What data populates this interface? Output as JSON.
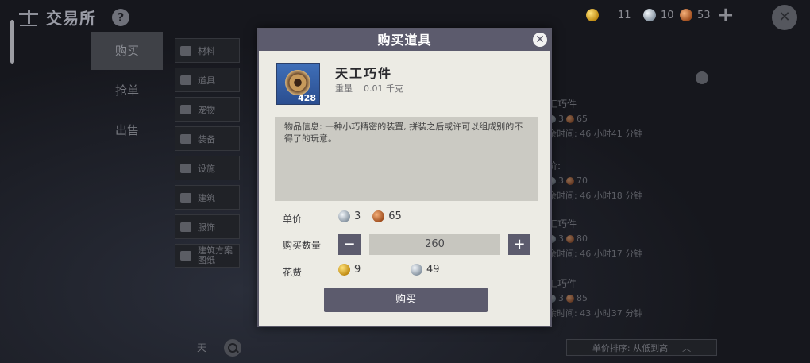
{
  "header": {
    "title": "交易所",
    "help_label": "?",
    "currency": {
      "gold": "11",
      "silver": "10",
      "copper": "53"
    },
    "add_label": "+",
    "close_label": "✕"
  },
  "left_tabs": [
    {
      "label": "购买",
      "active": true
    },
    {
      "label": "抢单",
      "active": false
    },
    {
      "label": "出售",
      "active": false
    }
  ],
  "categories": [
    {
      "label": "材料",
      "icon": "material-icon"
    },
    {
      "label": "道具",
      "icon": "prop-icon"
    },
    {
      "label": "宠物",
      "icon": "pet-icon"
    },
    {
      "label": "装备",
      "icon": "equipment-icon"
    },
    {
      "label": "设施",
      "icon": "facility-icon"
    },
    {
      "label": "建筑",
      "icon": "building-icon"
    },
    {
      "label": "服饰",
      "icon": "clothing-icon"
    },
    {
      "label": "建筑方案\n图纸",
      "icon": "blueprint-icon"
    }
  ],
  "search": {
    "value": "天"
  },
  "listings": [
    {
      "name": "工巧件",
      "silver": "3",
      "copper": "65",
      "time": "余时间: 46 小时41 分钟"
    },
    {
      "name": "价:",
      "silver": "3",
      "copper": "70",
      "time": "余时间: 46 小时18 分钟"
    },
    {
      "name": "工巧件",
      "silver": "3",
      "copper": "80",
      "time": "余时间: 46 小时17 分钟"
    },
    {
      "name": "工巧件",
      "silver": "3",
      "copper": "85",
      "time": "余时间: 43 小时37 分钟"
    }
  ],
  "sort": {
    "label": "单价排序: 从低到高",
    "icon": "chevron-up-icon"
  },
  "modal": {
    "title": "购买道具",
    "close_label": "✕",
    "item": {
      "name": "天工巧件",
      "count": "428",
      "weight_label": "重量",
      "weight_value": "0.01 千克"
    },
    "description": "物品信息: 一种小巧精密的装置, 拼装之后或许可以组成别的不得了的玩意。",
    "unit_price_label": "单价",
    "unit_price": {
      "silver": "3",
      "copper": "65"
    },
    "quantity_label": "购买数量",
    "quantity": "260",
    "decrement_label": "−",
    "increment_label": "+",
    "cost_label": "花费",
    "cost": {
      "gold": "9",
      "silver": "49"
    },
    "buy_label": "购买"
  },
  "colors": {
    "accent": "#5c5b6d",
    "panel": "#ecebe4",
    "desc_bg": "#cbcac3"
  }
}
